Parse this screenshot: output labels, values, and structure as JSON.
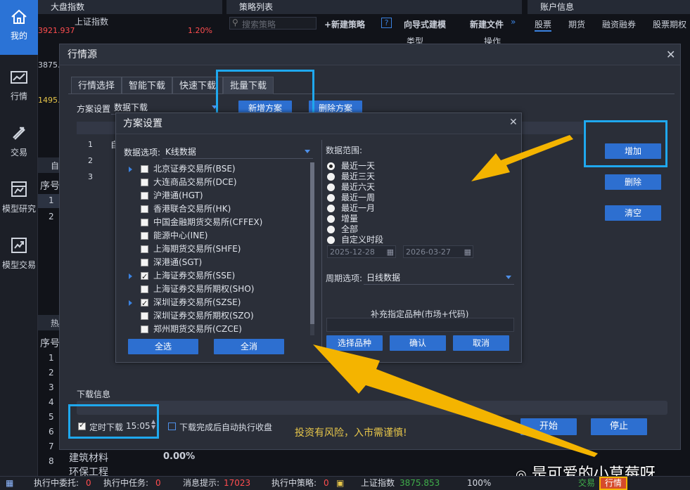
{
  "sidebar": {
    "items": [
      {
        "label": "我的",
        "icon": "home-icon",
        "active": true
      },
      {
        "label": "行情",
        "icon": "chart-icon"
      },
      {
        "label": "交易",
        "icon": "trade-icon"
      },
      {
        "label": "模型研究",
        "icon": "model-research-icon"
      },
      {
        "label": "模型交易",
        "icon": "model-trade-icon"
      }
    ]
  },
  "background": {
    "market_panel_title": "大盘指数",
    "index_name": "上证指数",
    "index_value": "3921.937",
    "index_change": "1.20%",
    "axis_1": "3875.",
    "axis_2": "1495.",
    "strategy_panel_title": "策略列表",
    "search_placeholder": "搜索策略",
    "new_strategy": "+新建策略",
    "help": "?",
    "guided_model": "向导式建模",
    "new_file": "新建文件",
    "col_type": "类型",
    "col_op": "操作",
    "account_panel_title": "账户信息",
    "account_tabs": [
      "股票",
      "期货",
      "融资融券",
      "股票期权"
    ],
    "side_label_1": "自",
    "side_label_2": "热",
    "seq_header": "序号",
    "rows_top": [
      "1",
      "2"
    ],
    "rows_bottom": [
      "1",
      "2",
      "3",
      "4",
      "5",
      "6",
      "7",
      "8"
    ],
    "sector_1": "建筑材料",
    "sector_1_val": "0.00%",
    "sector_2": "环保工程"
  },
  "dialog": {
    "title": "行情源",
    "tabs": [
      "行情选择",
      "智能下载",
      "快速下载",
      "批量下载"
    ],
    "active_tab": 3,
    "scheme_label": "方案设置",
    "scheme_value": "数据下载",
    "new_scheme_button": "新增方案",
    "delete_scheme_button": "删除方案",
    "list_rows": [
      "1",
      "2",
      "3"
    ],
    "list_row1_text": "自",
    "add_button": "增加",
    "delete_button": "删除",
    "clear_button": "清空",
    "download_info_label": "下载信息",
    "timed_download_label": "定时下载",
    "timed_download_checked": true,
    "timed_download_time": "15:05",
    "auto_collect_label": "下载完成后自动执行收盘",
    "auto_collect_checked": false,
    "warning_text": "投资有风险，入市需谨慎!",
    "start_button": "开始",
    "stop_button": "停止"
  },
  "scheme_dialog": {
    "title": "方案设置",
    "data_option_label": "数据选项:",
    "data_option_value": "K线数据",
    "exchanges": [
      {
        "label": "北京证券交易所(BSE)",
        "expandable": true,
        "checked": false
      },
      {
        "label": "大连商品交易所(DCE)",
        "expandable": false,
        "checked": false
      },
      {
        "label": "沪港通(HGT)",
        "expandable": false,
        "checked": false
      },
      {
        "label": "香港联合交易所(HK)",
        "expandable": false,
        "checked": false
      },
      {
        "label": "中国金融期货交易所(CFFEX)",
        "expandable": false,
        "checked": false
      },
      {
        "label": "能源中心(INE)",
        "expandable": false,
        "checked": false
      },
      {
        "label": "上海期货交易所(SHFE)",
        "expandable": false,
        "checked": false
      },
      {
        "label": "深港通(SGT)",
        "expandable": false,
        "checked": false
      },
      {
        "label": "上海证券交易所(SSE)",
        "expandable": true,
        "checked": true
      },
      {
        "label": "上海证券交易所期权(SHO)",
        "expandable": false,
        "checked": false
      },
      {
        "label": "深圳证券交易所(SZSE)",
        "expandable": true,
        "checked": true
      },
      {
        "label": "深圳证券交易所期权(SZO)",
        "expandable": false,
        "checked": false
      },
      {
        "label": "郑州期货交易所(CZCE)",
        "expandable": false,
        "checked": false
      }
    ],
    "select_all_button": "全选",
    "deselect_all_button": "全消",
    "range_label": "数据范围:",
    "ranges": [
      "最近一天",
      "最近三天",
      "最近六天",
      "最近一周",
      "最近一月",
      "增量",
      "全部",
      "自定义时段"
    ],
    "selected_range": 0,
    "date_start": "2025-12-28",
    "date_end": "2026-03-27",
    "period_label": "周期选项:",
    "period_value": "日线数据",
    "supplement_label": "补充指定品种(市场+代码)",
    "choose_button": "选择品种",
    "confirm_button": "确认",
    "cancel_button": "取消"
  },
  "status_bar": {
    "entrust_label": "执行中委托:",
    "entrust_count": "0",
    "task_label": "执行中任务:",
    "task_count": "0",
    "msg_label": "消息提示:",
    "msg_count": "17023",
    "strategy_label": "执行中策略:",
    "strategy_count": "0",
    "index_label": "上证指数",
    "index_value": "3875.853",
    "zoom": "100%",
    "trade_label": "交易",
    "quote_label": "行情"
  },
  "watermark": "是可爱的小草莓呀",
  "colors": {
    "accent": "#2d6fd0",
    "highlight": "#1fa8ee",
    "arrow": "#f4b400",
    "red": "#ff4d4f",
    "warning": "#e7c64a"
  }
}
